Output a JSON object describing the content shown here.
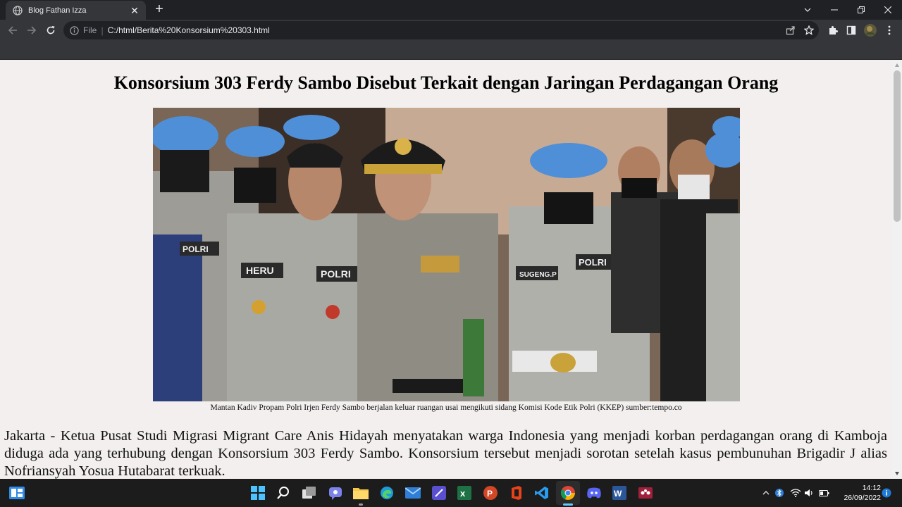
{
  "browser": {
    "tab_title": "Blog Fathan Izza",
    "file_label": "File",
    "url": "C:/html/Berita%20Konsorsium%20303.html"
  },
  "article": {
    "headline": "Konsorsium 303 Ferdy Sambo Disebut Terkait dengan Jaringan Perdagangan Orang",
    "photo_caption": "Mantan Kadiv Propam Polri Irjen Ferdy Sambo berjalan keluar ruangan usai mengikuti sidang Komisi Kode Etik Polri (KKEP) sumber:tempo.co",
    "paragraph_1": "Jakarta - Ketua Pusat Studi Migrasi Migrant Care Anis Hidayah menyatakan warga Indonesia yang menjadi korban perdagangan orang di Kamboja diduga ada yang terhubung dengan Konsorsium 303 Ferdy Sambo. Konsorsium tersebut menjadi sorotan setelah kasus pembunuhan Brigadir J alias Nofriansyah Yosua Hutabarat terkuak.",
    "photo_texts": {
      "patch_1": "POLRI",
      "patch_2": "POLRI",
      "patch_3": "POLRI",
      "name_1": "HERU",
      "name_2": "SUGENG.P"
    }
  },
  "taskbar": {
    "time": "14:12",
    "date": "26/09/2022"
  },
  "colors": {
    "page_bg": "#f2efee",
    "chrome_dark": "#202124",
    "chrome_toolbar": "#35363a",
    "beret_blue": "#4f8fd8",
    "uniform_grey": "#a9a9a3"
  }
}
